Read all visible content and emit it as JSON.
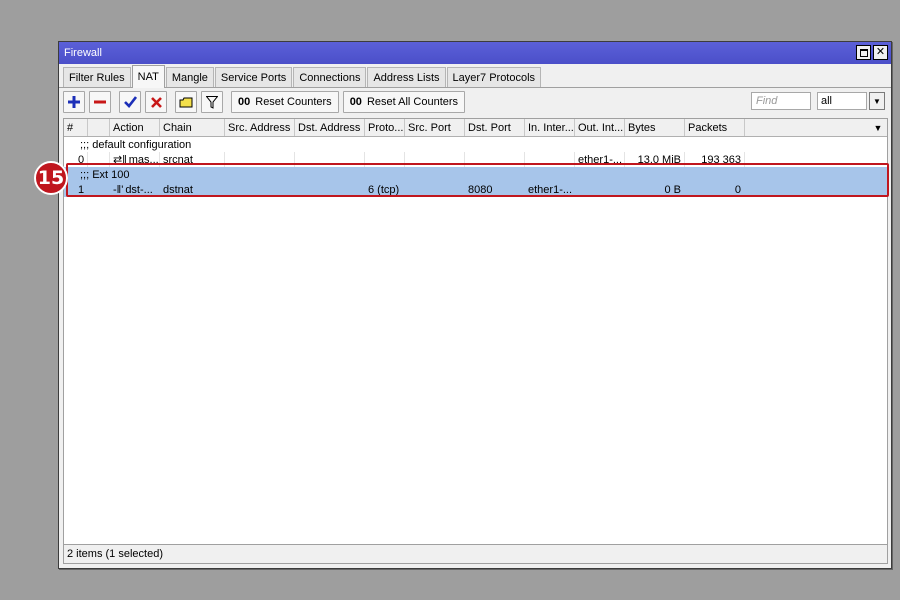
{
  "window": {
    "title": "Firewall"
  },
  "tabs": [
    "Filter Rules",
    "NAT",
    "Mangle",
    "Service Ports",
    "Connections",
    "Address Lists",
    "Layer7 Protocols"
  ],
  "toolbar": {
    "reset_counters": "Reset Counters",
    "reset_all_counters": "Reset All Counters",
    "counter_icon": "00",
    "find_placeholder": "Find",
    "filter_value": "all"
  },
  "table": {
    "columns": [
      "#",
      "Action",
      "Chain",
      "Src. Address",
      "Dst. Address",
      "Proto...",
      "Src. Port",
      "Dst. Port",
      "In. Inter...",
      "Out. Int...",
      "Bytes",
      "Packets"
    ],
    "groups": [
      {
        "comment": ";;; default configuration",
        "row": {
          "num": "0",
          "action_icon": "⇄‖",
          "action": "mas...",
          "chain": "srcnat",
          "src_address": "",
          "dst_address": "",
          "protocol": "",
          "src_port": "",
          "dst_port": "",
          "in_interface": "",
          "out_interface": "ether1-...",
          "bytes": "13.0 MiB",
          "packets": "193 363"
        }
      },
      {
        "comment": ";;; Ext 100",
        "row": {
          "num": "1",
          "action_icon": "-‖'",
          "action": "dst-...",
          "chain": "dstnat",
          "src_address": "",
          "dst_address": "",
          "protocol": "6 (tcp)",
          "src_port": "",
          "dst_port": "8080",
          "in_interface": "ether1-...",
          "out_interface": "",
          "bytes": "0 B",
          "packets": "0"
        }
      }
    ]
  },
  "status": "2 items (1 selected)",
  "annotation": {
    "label": "15",
    "color": "#c0161e"
  },
  "colors": {
    "titlebar": "#4b4fc9",
    "selection": "#a7c5ea"
  }
}
